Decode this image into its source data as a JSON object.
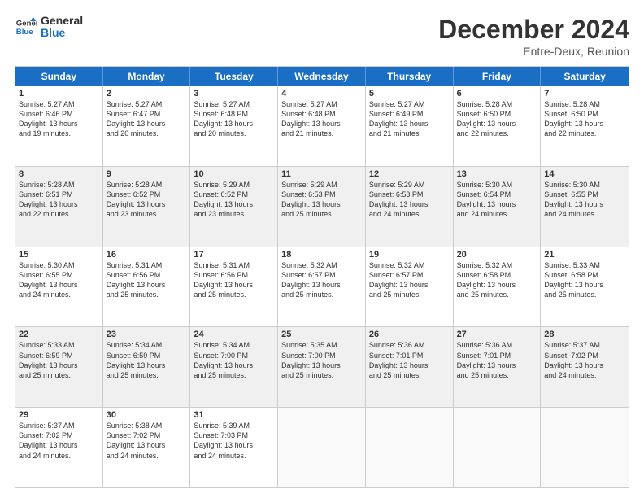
{
  "logo": {
    "line1": "General",
    "line2": "Blue"
  },
  "title": "December 2024",
  "subtitle": "Entre-Deux, Reunion",
  "header_days": [
    "Sunday",
    "Monday",
    "Tuesday",
    "Wednesday",
    "Thursday",
    "Friday",
    "Saturday"
  ],
  "rows": [
    [
      {
        "day": "1",
        "text": "Sunrise: 5:27 AM\nSunset: 6:46 PM\nDaylight: 13 hours\nand 19 minutes."
      },
      {
        "day": "2",
        "text": "Sunrise: 5:27 AM\nSunset: 6:47 PM\nDaylight: 13 hours\nand 20 minutes."
      },
      {
        "day": "3",
        "text": "Sunrise: 5:27 AM\nSunset: 6:48 PM\nDaylight: 13 hours\nand 20 minutes."
      },
      {
        "day": "4",
        "text": "Sunrise: 5:27 AM\nSunset: 6:48 PM\nDaylight: 13 hours\nand 21 minutes."
      },
      {
        "day": "5",
        "text": "Sunrise: 5:27 AM\nSunset: 6:49 PM\nDaylight: 13 hours\nand 21 minutes."
      },
      {
        "day": "6",
        "text": "Sunrise: 5:28 AM\nSunset: 6:50 PM\nDaylight: 13 hours\nand 22 minutes."
      },
      {
        "day": "7",
        "text": "Sunrise: 5:28 AM\nSunset: 6:50 PM\nDaylight: 13 hours\nand 22 minutes."
      }
    ],
    [
      {
        "day": "8",
        "text": "Sunrise: 5:28 AM\nSunset: 6:51 PM\nDaylight: 13 hours\nand 22 minutes."
      },
      {
        "day": "9",
        "text": "Sunrise: 5:28 AM\nSunset: 6:52 PM\nDaylight: 13 hours\nand 23 minutes."
      },
      {
        "day": "10",
        "text": "Sunrise: 5:29 AM\nSunset: 6:52 PM\nDaylight: 13 hours\nand 23 minutes."
      },
      {
        "day": "11",
        "text": "Sunrise: 5:29 AM\nSunset: 6:53 PM\nDaylight: 13 hours\nand 25 minutes."
      },
      {
        "day": "12",
        "text": "Sunrise: 5:29 AM\nSunset: 6:53 PM\nDaylight: 13 hours\nand 24 minutes."
      },
      {
        "day": "13",
        "text": "Sunrise: 5:30 AM\nSunset: 6:54 PM\nDaylight: 13 hours\nand 24 minutes."
      },
      {
        "day": "14",
        "text": "Sunrise: 5:30 AM\nSunset: 6:55 PM\nDaylight: 13 hours\nand 24 minutes."
      }
    ],
    [
      {
        "day": "15",
        "text": "Sunrise: 5:30 AM\nSunset: 6:55 PM\nDaylight: 13 hours\nand 24 minutes."
      },
      {
        "day": "16",
        "text": "Sunrise: 5:31 AM\nSunset: 6:56 PM\nDaylight: 13 hours\nand 25 minutes."
      },
      {
        "day": "17",
        "text": "Sunrise: 5:31 AM\nSunset: 6:56 PM\nDaylight: 13 hours\nand 25 minutes."
      },
      {
        "day": "18",
        "text": "Sunrise: 5:32 AM\nSunset: 6:57 PM\nDaylight: 13 hours\nand 25 minutes."
      },
      {
        "day": "19",
        "text": "Sunrise: 5:32 AM\nSunset: 6:57 PM\nDaylight: 13 hours\nand 25 minutes."
      },
      {
        "day": "20",
        "text": "Sunrise: 5:32 AM\nSunset: 6:58 PM\nDaylight: 13 hours\nand 25 minutes."
      },
      {
        "day": "21",
        "text": "Sunrise: 5:33 AM\nSunset: 6:58 PM\nDaylight: 13 hours\nand 25 minutes."
      }
    ],
    [
      {
        "day": "22",
        "text": "Sunrise: 5:33 AM\nSunset: 6:59 PM\nDaylight: 13 hours\nand 25 minutes."
      },
      {
        "day": "23",
        "text": "Sunrise: 5:34 AM\nSunset: 6:59 PM\nDaylight: 13 hours\nand 25 minutes."
      },
      {
        "day": "24",
        "text": "Sunrise: 5:34 AM\nSunset: 7:00 PM\nDaylight: 13 hours\nand 25 minutes."
      },
      {
        "day": "25",
        "text": "Sunrise: 5:35 AM\nSunset: 7:00 PM\nDaylight: 13 hours\nand 25 minutes."
      },
      {
        "day": "26",
        "text": "Sunrise: 5:36 AM\nSunset: 7:01 PM\nDaylight: 13 hours\nand 25 minutes."
      },
      {
        "day": "27",
        "text": "Sunrise: 5:36 AM\nSunset: 7:01 PM\nDaylight: 13 hours\nand 25 minutes."
      },
      {
        "day": "28",
        "text": "Sunrise: 5:37 AM\nSunset: 7:02 PM\nDaylight: 13 hours\nand 24 minutes."
      }
    ],
    [
      {
        "day": "29",
        "text": "Sunrise: 5:37 AM\nSunset: 7:02 PM\nDaylight: 13 hours\nand 24 minutes."
      },
      {
        "day": "30",
        "text": "Sunrise: 5:38 AM\nSunset: 7:02 PM\nDaylight: 13 hours\nand 24 minutes."
      },
      {
        "day": "31",
        "text": "Sunrise: 5:39 AM\nSunset: 7:03 PM\nDaylight: 13 hours\nand 24 minutes."
      },
      {
        "day": "",
        "text": ""
      },
      {
        "day": "",
        "text": ""
      },
      {
        "day": "",
        "text": ""
      },
      {
        "day": "",
        "text": ""
      }
    ]
  ]
}
